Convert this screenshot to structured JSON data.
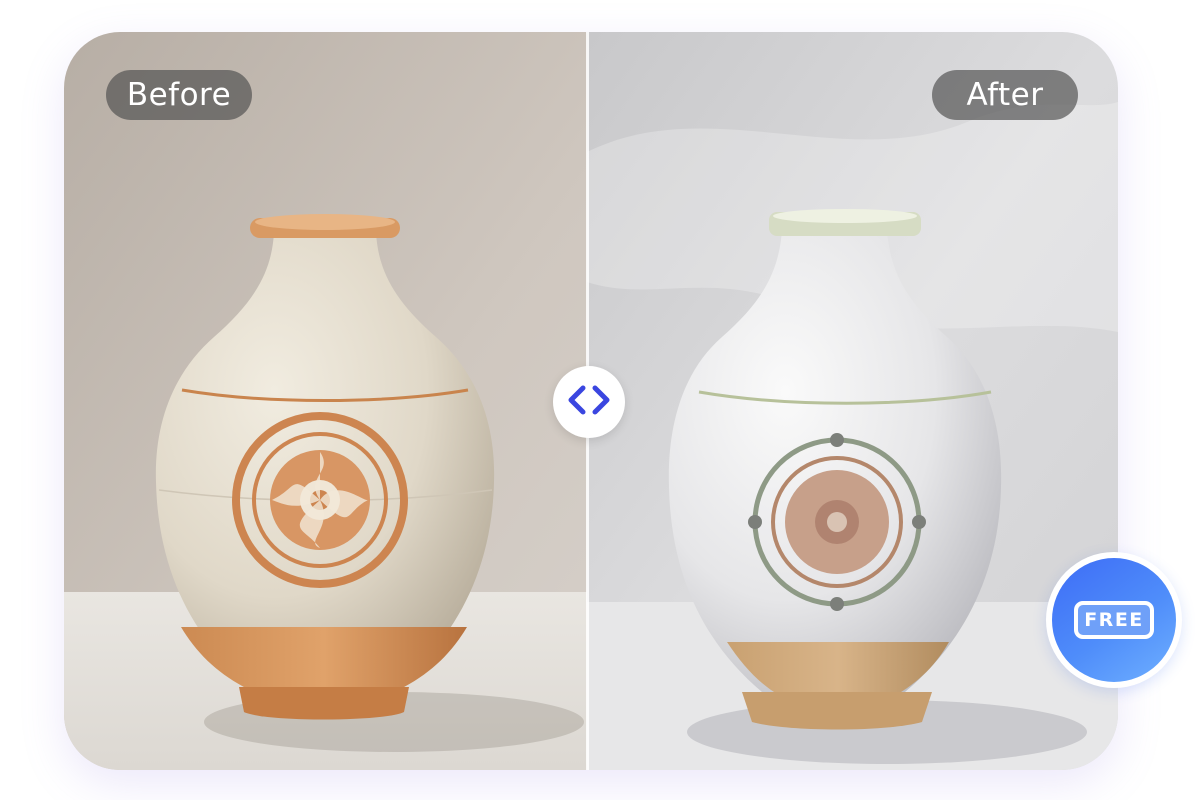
{
  "comparison": {
    "before_label": "Before",
    "after_label": "After",
    "slider_position": 0.5
  },
  "promo": {
    "free_label": "FREE"
  },
  "icons": {
    "slider_handle": "chevron-left-right-icon"
  },
  "colors": {
    "accent": "#3A46E0",
    "free_badge_start": "#3D6CF6",
    "free_badge_end": "#6FB0FF",
    "label_bg": "#505050"
  }
}
